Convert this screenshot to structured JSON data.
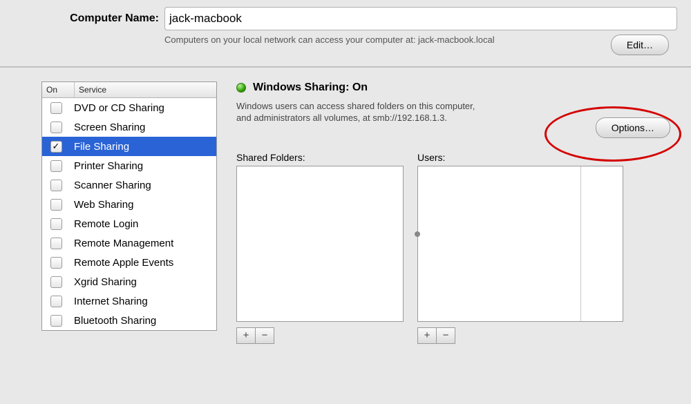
{
  "top": {
    "computer_name_label": "Computer Name:",
    "computer_name_value": "jack-macbook",
    "help_text": "Computers on your local network can access your computer at: jack-macbook.local",
    "edit_label": "Edit…"
  },
  "services": {
    "header_on": "On",
    "header_service": "Service",
    "items": [
      {
        "label": "DVD or CD Sharing",
        "checked": false,
        "selected": false
      },
      {
        "label": "Screen Sharing",
        "checked": false,
        "selected": false
      },
      {
        "label": "File Sharing",
        "checked": true,
        "selected": true
      },
      {
        "label": "Printer Sharing",
        "checked": false,
        "selected": false
      },
      {
        "label": "Scanner Sharing",
        "checked": false,
        "selected": false
      },
      {
        "label": "Web Sharing",
        "checked": false,
        "selected": false
      },
      {
        "label": "Remote Login",
        "checked": false,
        "selected": false
      },
      {
        "label": "Remote Management",
        "checked": false,
        "selected": false
      },
      {
        "label": "Remote Apple Events",
        "checked": false,
        "selected": false
      },
      {
        "label": "Xgrid Sharing",
        "checked": false,
        "selected": false
      },
      {
        "label": "Internet Sharing",
        "checked": false,
        "selected": false
      },
      {
        "label": "Bluetooth Sharing",
        "checked": false,
        "selected": false
      }
    ]
  },
  "detail": {
    "status_title": "Windows Sharing: On",
    "status_desc": "Windows users can access shared folders on this computer, and administrators all volumes, at smb://192.168.1.3.",
    "options_label": "Options…",
    "shared_folders_label": "Shared Folders:",
    "users_label": "Users:",
    "plus": "+",
    "minus": "−"
  }
}
